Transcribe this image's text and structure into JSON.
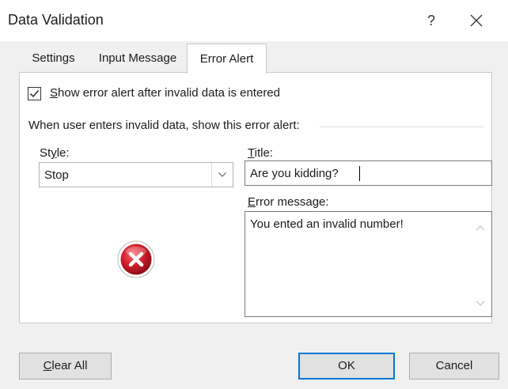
{
  "window": {
    "title": "Data Validation",
    "help": "?",
    "close_icon": "close-icon"
  },
  "tabs": [
    {
      "label": "Settings",
      "active": false
    },
    {
      "label": "Input Message",
      "active": false
    },
    {
      "label": "Error Alert",
      "active": true
    }
  ],
  "checkbox": {
    "label_pre": "",
    "label_underline": "S",
    "label_post": "how error alert after invalid data is entered",
    "checked": true
  },
  "group": {
    "label": "When user enters invalid data, show this error alert:"
  },
  "style": {
    "label_pre": "St",
    "label_underline": "y",
    "label_post": "le:",
    "value": "Stop",
    "icon": "error-x-icon"
  },
  "title_field": {
    "label_underline": "T",
    "label_post": "itle:",
    "value": "Are you kidding?"
  },
  "error_message": {
    "label_underline": "E",
    "label_post": "rror message:",
    "value": "You ented an invalid number!"
  },
  "buttons": {
    "clear_underline": "C",
    "clear_post": "lear All",
    "ok": "OK",
    "cancel": "Cancel"
  },
  "colors": {
    "accent": "#0078d7",
    "error_red": "#c8102e"
  }
}
